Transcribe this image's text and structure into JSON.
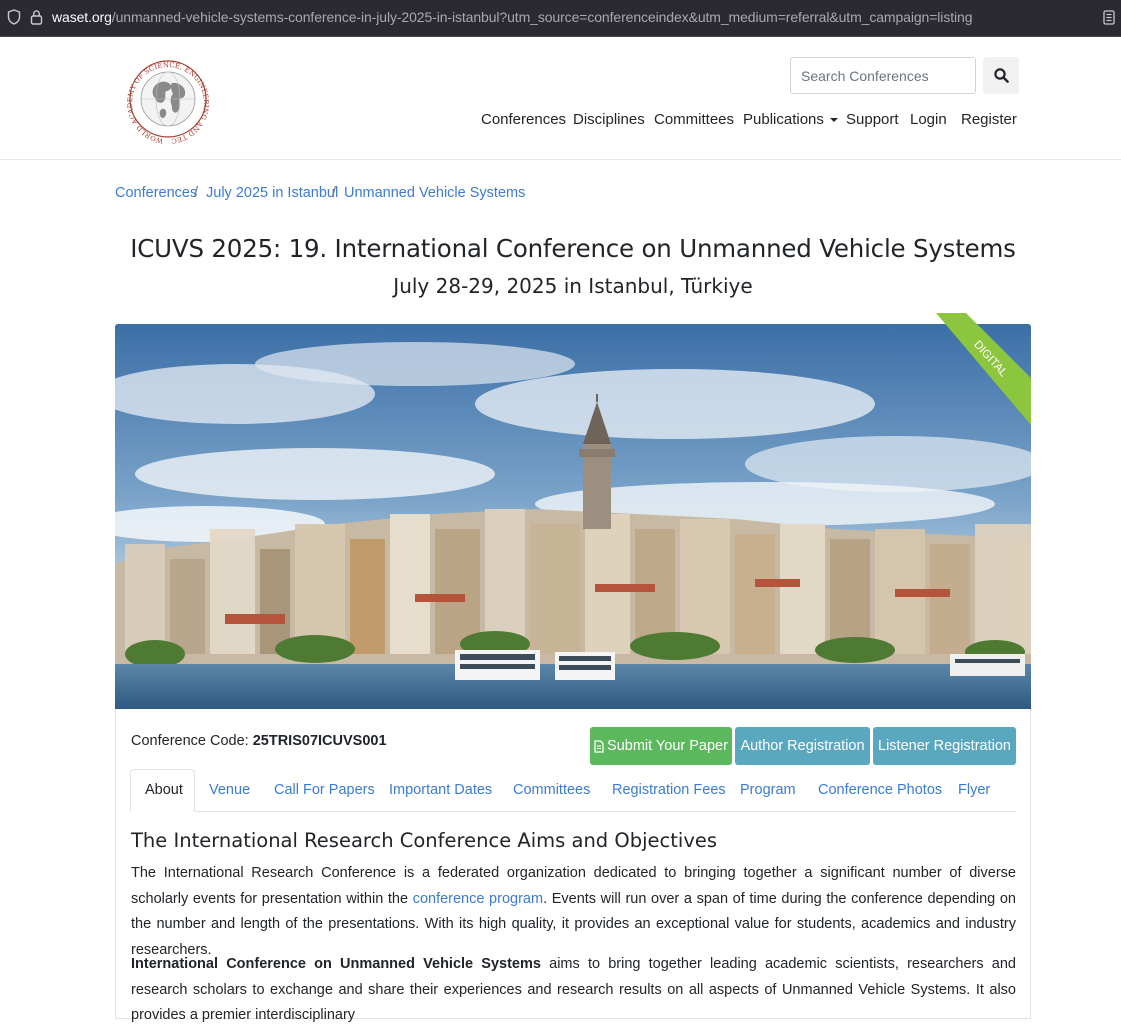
{
  "browser": {
    "url_host": "waset.org",
    "url_path": "/unmanned-vehicle-systems-conference-in-july-2025-in-istanbul?utm_source=conferenceindex&utm_medium=referral&utm_campaign=listing"
  },
  "header": {
    "logo_text": "WORLD ACADEMY OF SCIENCE, ENGINEERING AND TECHNOLOGY",
    "search_placeholder": "Search Conferences",
    "nav": [
      "Conferences",
      "Disciplines",
      "Committees",
      "Publications",
      "Support",
      "Login",
      "Register"
    ]
  },
  "breadcrumb": [
    "Conferences",
    "July 2025 in Istanbul",
    "Unmanned Vehicle Systems"
  ],
  "page": {
    "title": "ICUVS 2025: 19. International Conference on Unmanned Vehicle Systems",
    "subtitle": "July 28-29, 2025 in Istanbul, Türkiye",
    "ribbon": "DIGITAL"
  },
  "conference": {
    "code_label": "Conference Code:",
    "code": "25TRIS07ICUVS001"
  },
  "actions": {
    "submit": "Submit Your Paper",
    "author": "Author Registration",
    "listener": "Listener Registration"
  },
  "tabs": [
    "About",
    "Venue",
    "Call For Papers",
    "Important Dates",
    "Committees",
    "Registration Fees",
    "Program",
    "Conference Photos",
    "Flyer"
  ],
  "content": {
    "heading": "The International Research Conference Aims and Objectives",
    "p1_before": "The International Research Conference is a federated organization dedicated to bringing together a significant number of diverse scholarly events for presentation within the ",
    "p1_link": "conference program",
    "p1_after": ". Events will run over a span of time during the conference depending on the number and length of the presentations. With its high quality, it provides an exceptional value for students, academics and industry researchers.",
    "p2_bold": "International Conference on Unmanned Vehicle Systems",
    "p2_rest": " aims to bring together leading academic scientists, researchers and research scholars to exchange and share their experiences and research results on all aspects of Unmanned Vehicle Systems. It also provides a premier interdisciplinary"
  },
  "colors": {
    "link": "#3b7bd4",
    "success": "#5cb85c",
    "info": "#5aa8bf",
    "ribbon": "#8cc63f"
  }
}
